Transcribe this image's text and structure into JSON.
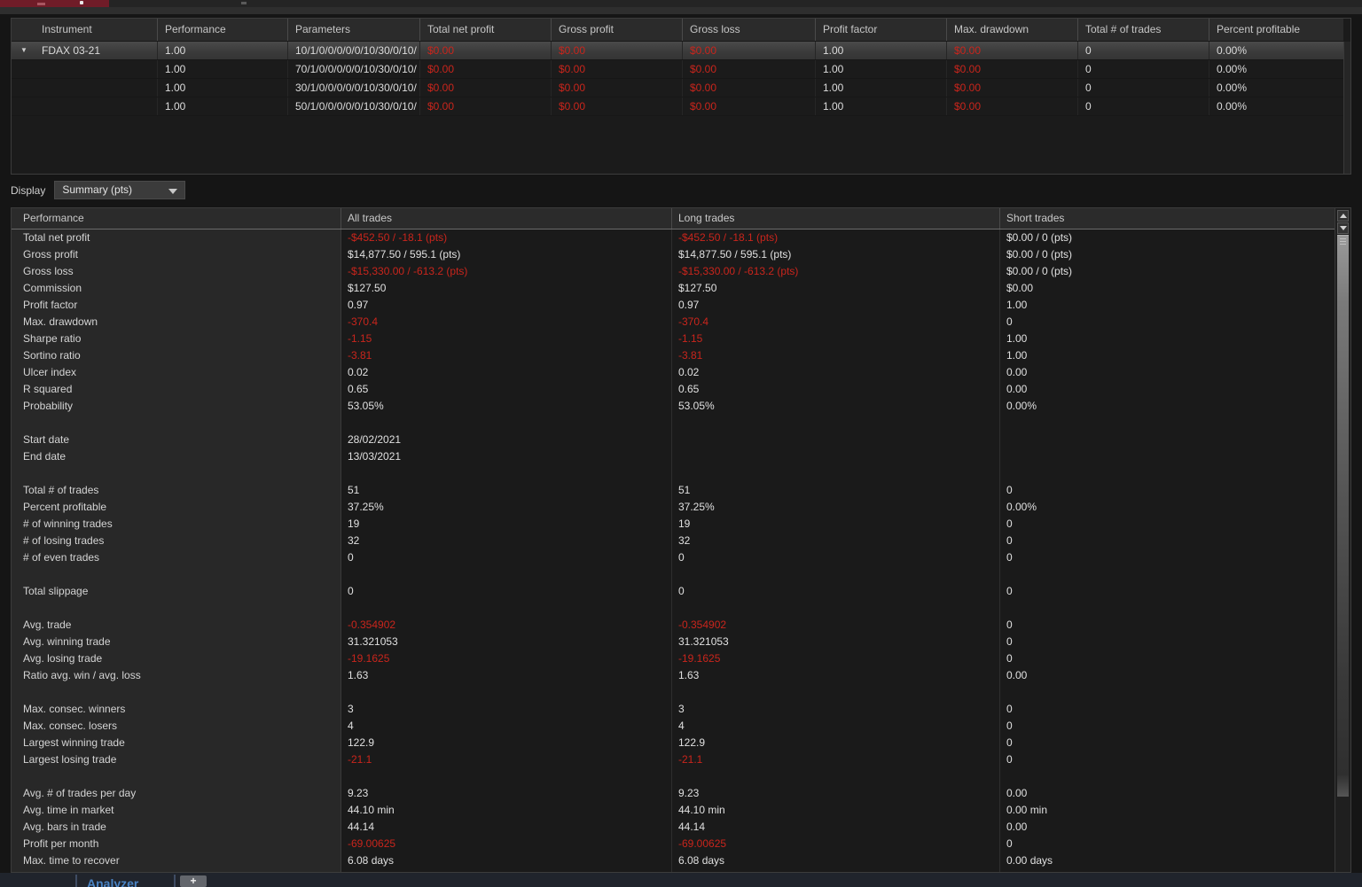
{
  "colors": {
    "negative": "#c9251c",
    "accent_tab": "#4a84c4",
    "window_tab_red": "#701c28"
  },
  "top_table": {
    "columns": [
      "Instrument",
      "Performance",
      "Parameters",
      "Total net profit",
      "Gross profit",
      "Gross loss",
      "Profit factor",
      "Max. drawdown",
      "Total # of trades",
      "Percent profitable"
    ],
    "red_columns": [
      3,
      4,
      5,
      7
    ],
    "rows": [
      {
        "selected": true,
        "expanded": true,
        "cells": [
          "FDAX 03-21",
          "1.00",
          "10/1/0/0/0/0/0/10/30/0/10/",
          "$0.00",
          "$0.00",
          "$0.00",
          "1.00",
          "$0.00",
          "0",
          "0.00%"
        ]
      },
      {
        "cells": [
          "",
          "1.00",
          "70/1/0/0/0/0/0/10/30/0/10/",
          "$0.00",
          "$0.00",
          "$0.00",
          "1.00",
          "$0.00",
          "0",
          "0.00%"
        ]
      },
      {
        "cells": [
          "",
          "1.00",
          "30/1/0/0/0/0/0/10/30/0/10/",
          "$0.00",
          "$0.00",
          "$0.00",
          "1.00",
          "$0.00",
          "0",
          "0.00%"
        ]
      },
      {
        "cells": [
          "",
          "1.00",
          "50/1/0/0/0/0/0/10/30/0/10/",
          "$0.00",
          "$0.00",
          "$0.00",
          "1.00",
          "$0.00",
          "0",
          "0.00%"
        ]
      }
    ]
  },
  "display": {
    "label": "Display",
    "value": "Summary (pts)"
  },
  "perf_table": {
    "columns": [
      "Performance",
      "All trades",
      "Long trades",
      "Short trades"
    ],
    "rows": [
      {
        "label": "Total net profit",
        "values": [
          "-$452.50 / -18.1 (pts)",
          "-$452.50 / -18.1 (pts)",
          "$0.00 / 0 (pts)"
        ],
        "neg": [
          1,
          1,
          0
        ]
      },
      {
        "label": "Gross profit",
        "values": [
          "$14,877.50 / 595.1 (pts)",
          "$14,877.50 / 595.1 (pts)",
          "$0.00 / 0 (pts)"
        ],
        "neg": [
          0,
          0,
          0
        ]
      },
      {
        "label": "Gross loss",
        "values": [
          "-$15,330.00 / -613.2 (pts)",
          "-$15,330.00 / -613.2 (pts)",
          "$0.00 / 0 (pts)"
        ],
        "neg": [
          1,
          1,
          0
        ]
      },
      {
        "label": "Commission",
        "values": [
          "$127.50",
          "$127.50",
          "$0.00"
        ],
        "neg": [
          0,
          0,
          0
        ]
      },
      {
        "label": "Profit factor",
        "values": [
          "0.97",
          "0.97",
          "1.00"
        ],
        "neg": [
          0,
          0,
          0
        ]
      },
      {
        "label": "Max. drawdown",
        "values": [
          "-370.4",
          "-370.4",
          "0"
        ],
        "neg": [
          1,
          1,
          0
        ]
      },
      {
        "label": "Sharpe ratio",
        "values": [
          "-1.15",
          "-1.15",
          "1.00"
        ],
        "neg": [
          1,
          1,
          0
        ]
      },
      {
        "label": "Sortino ratio",
        "values": [
          "-3.81",
          "-3.81",
          "1.00"
        ],
        "neg": [
          1,
          1,
          0
        ]
      },
      {
        "label": "Ulcer index",
        "values": [
          "0.02",
          "0.02",
          "0.00"
        ],
        "neg": [
          0,
          0,
          0
        ]
      },
      {
        "label": "R squared",
        "values": [
          "0.65",
          "0.65",
          "0.00"
        ],
        "neg": [
          0,
          0,
          0
        ]
      },
      {
        "label": "Probability",
        "values": [
          "53.05%",
          "53.05%",
          "0.00%"
        ],
        "neg": [
          0,
          0,
          0
        ]
      },
      {
        "blank": true
      },
      {
        "label": "Start date",
        "values": [
          "28/02/2021",
          "",
          ""
        ],
        "neg": [
          0,
          0,
          0
        ]
      },
      {
        "label": "End date",
        "values": [
          "13/03/2021",
          "",
          ""
        ],
        "neg": [
          0,
          0,
          0
        ]
      },
      {
        "blank": true
      },
      {
        "label": "Total # of trades",
        "values": [
          "51",
          "51",
          "0"
        ],
        "neg": [
          0,
          0,
          0
        ]
      },
      {
        "label": "Percent profitable",
        "values": [
          "37.25%",
          "37.25%",
          "0.00%"
        ],
        "neg": [
          0,
          0,
          0
        ]
      },
      {
        "label": "# of winning trades",
        "values": [
          "19",
          "19",
          "0"
        ],
        "neg": [
          0,
          0,
          0
        ]
      },
      {
        "label": "# of losing trades",
        "values": [
          "32",
          "32",
          "0"
        ],
        "neg": [
          0,
          0,
          0
        ]
      },
      {
        "label": "# of even trades",
        "values": [
          "0",
          "0",
          "0"
        ],
        "neg": [
          0,
          0,
          0
        ]
      },
      {
        "blank": true
      },
      {
        "label": "Total slippage",
        "values": [
          "0",
          "0",
          "0"
        ],
        "neg": [
          0,
          0,
          0
        ]
      },
      {
        "blank": true
      },
      {
        "label": "Avg. trade",
        "values": [
          "-0.354902",
          "-0.354902",
          "0"
        ],
        "neg": [
          1,
          1,
          0
        ]
      },
      {
        "label": "Avg. winning trade",
        "values": [
          "31.321053",
          "31.321053",
          "0"
        ],
        "neg": [
          0,
          0,
          0
        ]
      },
      {
        "label": "Avg. losing trade",
        "values": [
          "-19.1625",
          "-19.1625",
          "0"
        ],
        "neg": [
          1,
          1,
          0
        ]
      },
      {
        "label": "Ratio avg. win / avg. loss",
        "values": [
          "1.63",
          "1.63",
          "0.00"
        ],
        "neg": [
          0,
          0,
          0
        ]
      },
      {
        "blank": true
      },
      {
        "label": "Max. consec. winners",
        "values": [
          "3",
          "3",
          "0"
        ],
        "neg": [
          0,
          0,
          0
        ]
      },
      {
        "label": "Max. consec. losers",
        "values": [
          "4",
          "4",
          "0"
        ],
        "neg": [
          0,
          0,
          0
        ]
      },
      {
        "label": "Largest winning trade",
        "values": [
          "122.9",
          "122.9",
          "0"
        ],
        "neg": [
          0,
          0,
          0
        ]
      },
      {
        "label": "Largest losing trade",
        "values": [
          "-21.1",
          "-21.1",
          "0"
        ],
        "neg": [
          1,
          1,
          0
        ]
      },
      {
        "blank": true
      },
      {
        "label": "Avg. # of trades per day",
        "values": [
          "9.23",
          "9.23",
          "0.00"
        ],
        "neg": [
          0,
          0,
          0
        ]
      },
      {
        "label": "Avg. time in market",
        "values": [
          "44.10 min",
          "44.10 min",
          "0.00 min"
        ],
        "neg": [
          0,
          0,
          0
        ]
      },
      {
        "label": "Avg. bars in trade",
        "values": [
          "44.14",
          "44.14",
          "0.00"
        ],
        "neg": [
          0,
          0,
          0
        ]
      },
      {
        "label": "Profit per month",
        "values": [
          "-69.00625",
          "-69.00625",
          "0"
        ],
        "neg": [
          1,
          1,
          0
        ]
      },
      {
        "label": "Max. time to recover",
        "values": [
          "6.08 days",
          "6.08 days",
          "0.00 days"
        ],
        "neg": [
          0,
          0,
          0
        ]
      }
    ]
  },
  "bottom_bar": {
    "tab_label": "Analyzer",
    "add_button": "+"
  }
}
